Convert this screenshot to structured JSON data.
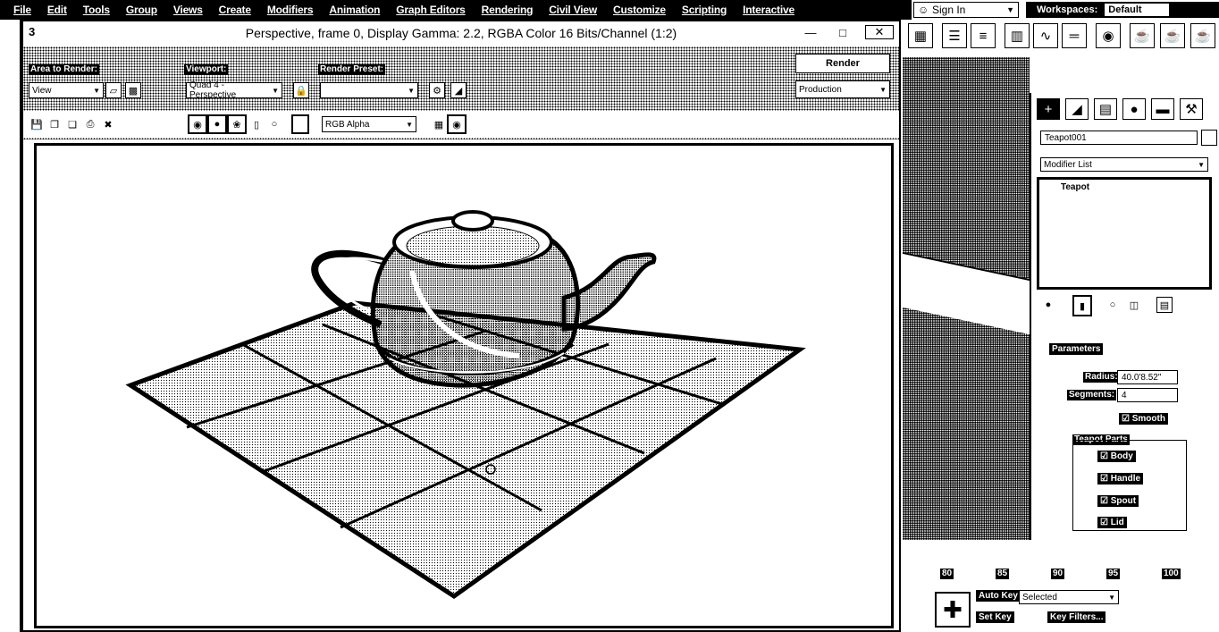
{
  "menubar": {
    "items": [
      "File",
      "Edit",
      "Tools",
      "Group",
      "Views",
      "Create",
      "Modifiers",
      "Animation",
      "Graph Editors",
      "Rendering",
      "Civil View",
      "Customize",
      "Scripting",
      "Interactive"
    ]
  },
  "account": {
    "signin_label": "Sign In"
  },
  "workspaces": {
    "label": "Workspaces:",
    "value": "Default"
  },
  "render_window": {
    "title": "Perspective, frame 0, Display Gamma: 2.2, RGBA Color 16 Bits/Channel (1:2)",
    "area_to_render": {
      "label": "Area to Render:",
      "value": "View"
    },
    "viewport": {
      "label": "Viewport:",
      "value": "Quad 4 - Perspective"
    },
    "render_preset": {
      "label": "Render Preset:",
      "value": ""
    },
    "render_button": "Render",
    "production": "Production",
    "channel": "RGB Alpha"
  },
  "command_panel": {
    "object_name": "Teapot001",
    "modifier_list": "Modifier List",
    "stack_item": "Teapot",
    "rollout": "Parameters",
    "radius_label": "Radius:",
    "radius_value": "40.0'8.52\"",
    "segments_label": "Segments:",
    "segments_value": "4",
    "smooth": "Smooth",
    "parts_label": "Teapot Parts",
    "parts": [
      "Body",
      "Handle",
      "Spout",
      "Lid"
    ]
  },
  "timeline": {
    "ticks": [
      "80",
      "85",
      "90",
      "95",
      "100"
    ],
    "auto_key": "Auto Key",
    "set_key": "Set Key",
    "selected": "Selected",
    "key_filters": "Key Filters..."
  }
}
